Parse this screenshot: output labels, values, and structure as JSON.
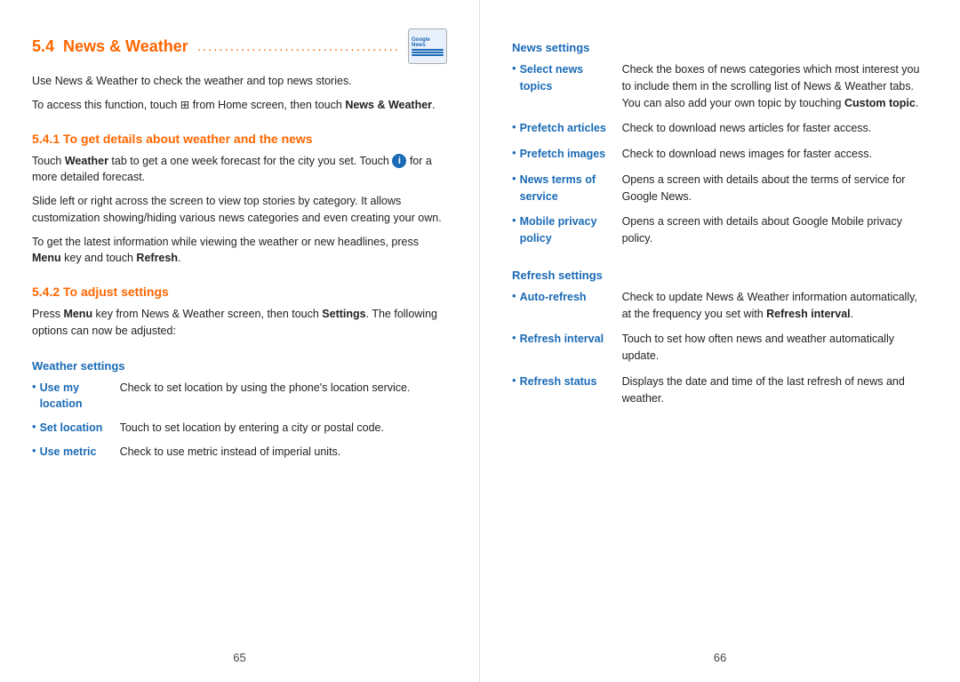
{
  "leftPage": {
    "pageNumber": "65",
    "sectionNumber": "5.4",
    "sectionTitle": "News & Weather",
    "sectionDots": ".......................................",
    "intro1": "Use News & Weather to check the weather and top news stories.",
    "intro2parts": [
      "To access this function, touch ",
      " from Home screen, then touch ",
      "News & Weather",
      "."
    ],
    "subsection1Number": "5.4.1",
    "subsection1Title": "To get details about weather and the news",
    "sub1p1parts": [
      "Touch ",
      "Weather",
      " tab to get a one week forecast for the city you set. Touch ",
      " for a more detailed forecast."
    ],
    "sub1p2": "Slide left or right across the screen to view top stories by category. It allows customization showing/hiding various news categories and even creating your own.",
    "sub1p3parts": [
      "To get the latest information while viewing the weather or new headlines, press ",
      "Menu",
      " key and touch ",
      "Refresh",
      "."
    ],
    "subsection2Number": "5.4.2",
    "subsection2Title": "To adjust settings",
    "sub2p1parts": [
      "Press ",
      "Menu",
      " key from News & Weather screen, then touch ",
      "Settings",
      ". The following options can now be adjusted:"
    ],
    "weatherSettings": "Weather settings",
    "weatherItems": [
      {
        "bullet": "•",
        "label": "Use my location",
        "desc": "Check to set location by using the phone's location service."
      },
      {
        "bullet": "•",
        "label": "Set location",
        "desc": "Touch to set location by entering a city or postal code."
      },
      {
        "bullet": "•",
        "label": "Use metric",
        "desc": "Check to use metric instead of imperial units."
      }
    ]
  },
  "rightPage": {
    "pageNumber": "66",
    "newsSettingsHeading": "News settings",
    "newsItems": [
      {
        "bullet": "•",
        "label": "Select news topics",
        "desc": "Check the boxes of news categories which most interest you to include them in the scrolling list of News & Weather tabs. You can also add your own topic by touching ",
        "descBold": "Custom topic",
        "descEnd": "."
      },
      {
        "bullet": "•",
        "label": "Prefetch articles",
        "desc": "Check to download news articles for faster access."
      },
      {
        "bullet": "•",
        "label": "Prefetch images",
        "desc": "Check to download news images for faster access."
      },
      {
        "bullet": "•",
        "label": "News terms of service",
        "desc": "Opens a screen with details about the terms of service for Google News."
      },
      {
        "bullet": "•",
        "label": "Mobile privacy policy",
        "desc": "Opens a screen with details about Google Mobile privacy policy."
      }
    ],
    "refreshSettingsHeading": "Refresh settings",
    "refreshItems": [
      {
        "bullet": "•",
        "label": "Auto-refresh",
        "descStart": "Check to update News & Weather information automatically, at the frequency you set with ",
        "descBold": "Refresh interval",
        "descEnd": "."
      },
      {
        "bullet": "•",
        "label": "Refresh interval",
        "desc": "Touch to set how often news and weather automatically update."
      },
      {
        "bullet": "•",
        "label": "Refresh status",
        "desc": "Displays the date and time of the last refresh of news and weather."
      }
    ]
  }
}
